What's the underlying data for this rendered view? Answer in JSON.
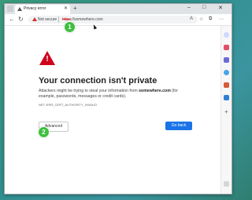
{
  "browser": {
    "tab_title": "Privacy error",
    "tab_close": "✕",
    "new_tab": "+",
    "window_controls": [
      "–",
      "□",
      "✕"
    ],
    "nav_back": "←",
    "nav_refresh": "↻",
    "security_label": "Not secure",
    "url_scheme": "https",
    "url_rest": "://somewhere.com"
  },
  "page": {
    "heading": "Your connection isn't private",
    "description_before": "Attackers might be trying to steal your information from ",
    "description_host": "somewhere.com",
    "description_after": " (for example, passwords, messages or credit cards).",
    "error_code": "NET::ERR_CERT_AUTHORITY_INVALID",
    "advanced_label": "Advanced",
    "go_back_label": "Go back"
  },
  "annotations": {
    "marker_1": "1",
    "marker_2": "2"
  },
  "colors": {
    "warning_red": "#d0021b",
    "primary_button": "#1a73e8",
    "marker_green": "#3fbf3f"
  }
}
